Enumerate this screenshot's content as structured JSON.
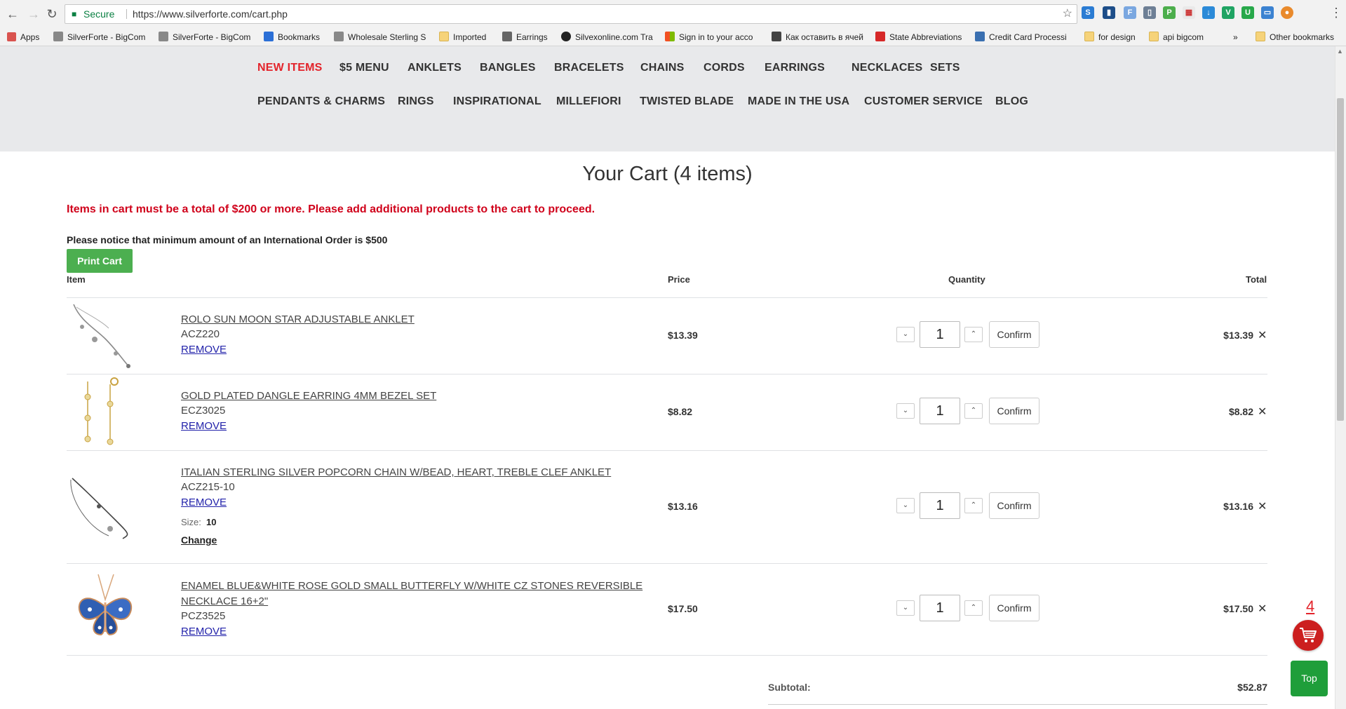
{
  "browser": {
    "secure_label": "Secure",
    "url": "https://www.silverforte.com/cart.php",
    "bookmarks": [
      {
        "label": "Apps",
        "icon": "apps-grid-icon"
      },
      {
        "label": "SilverForte - BigCom",
        "icon": "bigcommerce-icon"
      },
      {
        "label": "SilverForte - BigCom",
        "icon": "bigcommerce-icon"
      },
      {
        "label": "Bookmarks",
        "icon": "star-icon"
      },
      {
        "label": "Wholesale Sterling S",
        "icon": "bigcommerce-icon"
      },
      {
        "label": "Imported",
        "icon": "folder-icon"
      },
      {
        "label": "Earrings",
        "icon": "page-icon"
      },
      {
        "label": "Silvexonline.com Tra",
        "icon": "site-icon"
      },
      {
        "label": "Sign in to your acco",
        "icon": "microsoft-icon"
      },
      {
        "label": "Как оставить в ячей",
        "icon": "excel-icon"
      },
      {
        "label": "State Abbreviations",
        "icon": "af-icon"
      },
      {
        "label": "Credit Card Processi",
        "icon": "a-icon"
      },
      {
        "label": "for design",
        "icon": "folder-icon"
      },
      {
        "label": "api bigcom",
        "icon": "folder-icon"
      }
    ],
    "overflow_label": "»",
    "other_bookmarks": "Other bookmarks"
  },
  "nav": {
    "row1": [
      "NEW ITEMS",
      "$5 MENU",
      "ANKLETS",
      "BANGLES",
      "BRACELETS",
      "CHAINS",
      "CORDS",
      "EARRINGS",
      "NECKLACES",
      "SETS"
    ],
    "row2": [
      "PENDANTS & CHARMS",
      "RINGS",
      "INSPIRATIONAL",
      "MILLEFIORI",
      "TWISTED BLADE",
      "MADE IN THE USA",
      "CUSTOMER SERVICE",
      "BLOG"
    ]
  },
  "cart": {
    "title": "Your Cart (4 items)",
    "warning": "Items in cart must be a total of $200 or more. Please add additional products to the cart to proceed.",
    "intl_notice": "Please notice that minimum amount of an International Order is $500",
    "print_label": "Print Cart",
    "headers": {
      "item": "Item",
      "price": "Price",
      "quantity": "Quantity",
      "total": "Total"
    },
    "items": [
      {
        "name": "ROLO SUN MOON STAR ADJUSTABLE ANKLET",
        "sku": "ACZ220",
        "remove": "REMOVE",
        "price": "$13.39",
        "qty": "1",
        "confirm": "Confirm",
        "total": "$13.39"
      },
      {
        "name": "GOLD PLATED DANGLE EARRING 4MM BEZEL SET",
        "sku": "ECZ3025",
        "remove": "REMOVE",
        "price": "$8.82",
        "qty": "1",
        "confirm": "Confirm",
        "total": "$8.82"
      },
      {
        "name": "ITALIAN STERLING SILVER POPCORN CHAIN W/BEAD, HEART, TREBLE CLEF ANKLET",
        "sku": "ACZ215-10",
        "remove": "REMOVE",
        "size_label": "Size:",
        "size_value": "10",
        "change": "Change",
        "price": "$13.16",
        "qty": "1",
        "confirm": "Confirm",
        "total": "$13.16"
      },
      {
        "name": "ENAMEL BLUE&WHITE ROSE GOLD SMALL BUTTERFLY W/WHITE CZ STONES REVERSIBLE NECKLACE 16+2\"",
        "sku": "PCZ3525",
        "remove": "REMOVE",
        "price": "$17.50",
        "qty": "1",
        "confirm": "Confirm",
        "total": "$17.50"
      }
    ],
    "subtotal_label": "Subtotal:",
    "subtotal_value": "$52.87"
  },
  "floating": {
    "cart_count": "4",
    "top_label": "Top"
  },
  "colors": {
    "accent_red": "#e3242b",
    "print_green": "#4caf50",
    "top_green": "#1f9e3a",
    "warn_red": "#d0021b"
  }
}
